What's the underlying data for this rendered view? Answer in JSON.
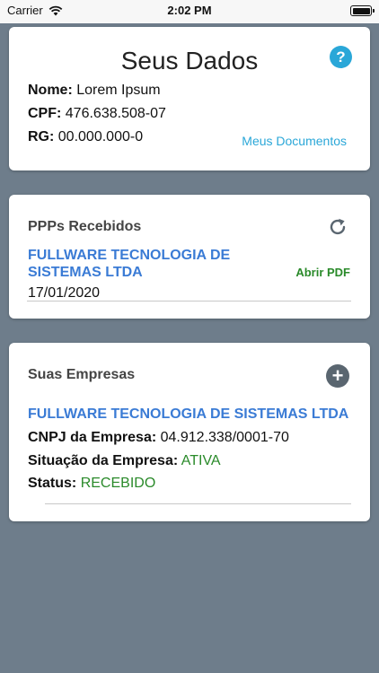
{
  "statusbar": {
    "carrier": "Carrier",
    "time": "2:02 PM"
  },
  "dados": {
    "title": "Seus Dados",
    "help_icon": "?",
    "nome_label": "Nome:",
    "nome_value": "Lorem Ipsum",
    "cpf_label": "CPF:",
    "cpf_value": "476.638.508-07",
    "rg_label": "RG:",
    "rg_value": "00.000.000-0",
    "docs_link": "Meus Documentos"
  },
  "ppp": {
    "title": "PPPs Recebidos",
    "company_line1": "FULLWARE TECNOLOGIA DE",
    "company_line2": "SISTEMAS LTDA",
    "abrir_pdf": "Abrir PDF",
    "date": "17/01/2020"
  },
  "empresas": {
    "title": "Suas Empresas",
    "add_icon": "+",
    "company": "FULLWARE TECNOLOGIA DE SISTEMAS LTDA",
    "cnpj_label": "CNPJ da Empresa:",
    "cnpj_value": "04.912.338/0001-70",
    "situacao_label": "Situação da Empresa:",
    "situacao_value": "ATIVA",
    "status_label": "Status:",
    "status_value": "RECEBIDO"
  },
  "colors": {
    "background": "#6e7d8b",
    "link_blue": "#3a7bd5",
    "accent_cyan": "#2aa7d8",
    "status_green": "#2a8a2a"
  }
}
